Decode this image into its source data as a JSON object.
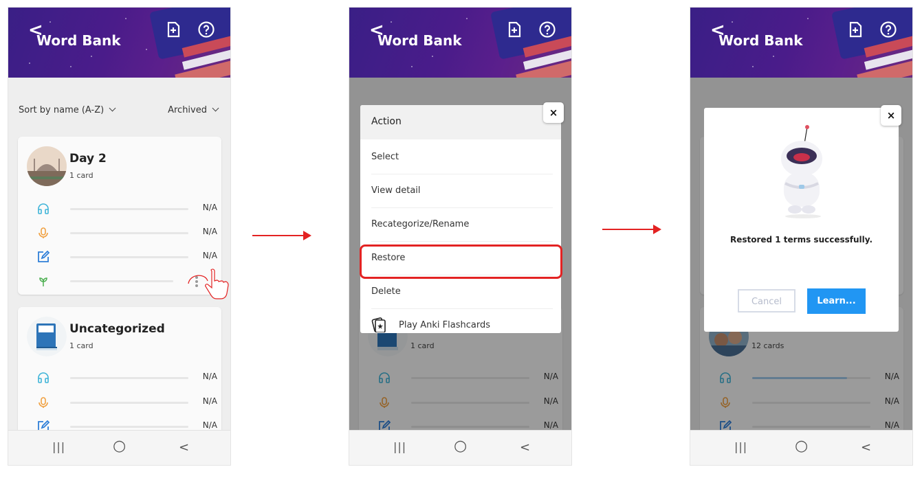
{
  "app": {
    "title": "Word Bank",
    "back_glyph": "<",
    "header_icons": [
      "add-file-icon",
      "help-icon"
    ]
  },
  "list": {
    "sort_label": "Sort by name (A-Z)",
    "filter_label": "Archived",
    "cards": [
      {
        "name": "Day 2",
        "count": "1 card",
        "values": [
          "N/A",
          "N/A",
          "N/A"
        ]
      },
      {
        "name": "Uncategorized",
        "count": "1 card",
        "values": [
          "N/A",
          "N/A",
          "N/A"
        ]
      }
    ],
    "card_behind_dialog": {
      "count": "12 cards",
      "values": [
        "N/A",
        "N/A",
        "N/A"
      ],
      "listening_progress": 0.8
    }
  },
  "stat_icons": [
    "headphones-icon",
    "microphone-icon",
    "edit-icon",
    "sprout-icon"
  ],
  "action_menu": {
    "header": "Action",
    "items": [
      "Select",
      "View detail",
      "Recategorize/Rename",
      "Restore",
      "Delete",
      "Play Anki Flashcards"
    ],
    "highlighted": "Restore",
    "background_card_count": "1 card",
    "background_values": [
      "N/A",
      "N/A",
      "N/A"
    ],
    "close_glyph": "×"
  },
  "result_dialog": {
    "message": "Restored 1 terms successfully.",
    "cancel_label": "Cancel",
    "learn_label": "Learn...",
    "close_glyph": "×"
  },
  "system_nav": {
    "recents": "|||",
    "home": "○",
    "back": "<"
  },
  "colors": {
    "header": "#3a1f86",
    "highlight": "#e32222",
    "learn_button": "#2196f3",
    "progress": "#9fc9e8",
    "listen_icon": "#3fb4d8",
    "mic_icon": "#f0a040",
    "edit_icon": "#2f7fd8",
    "sprout_icon": "#4caf50"
  }
}
